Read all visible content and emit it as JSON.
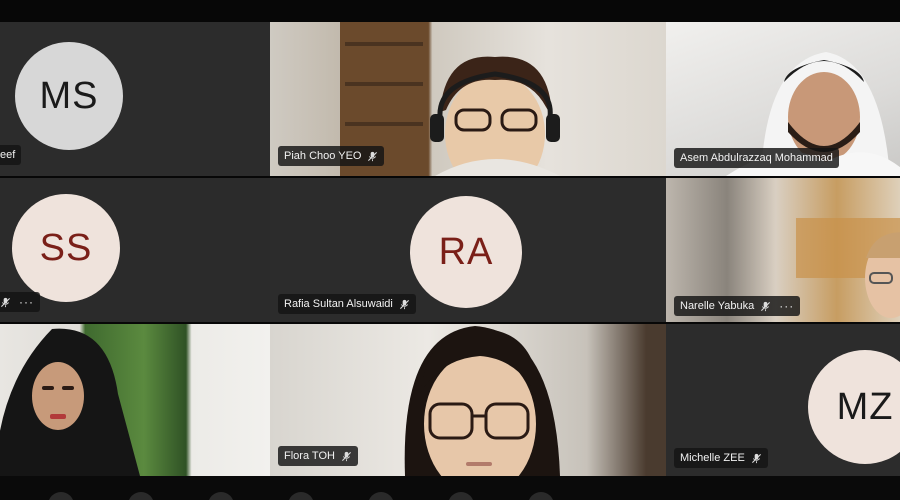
{
  "participants": [
    {
      "name": "Mohammed Shareef",
      "name_visible": "eef",
      "initials": "MS",
      "avatar_bg": "#d7d7d7",
      "avatar_fg": "#1a1a1a"
    },
    {
      "name": "Piah Choo YEO"
    },
    {
      "name": "Asem Abdulrazzaq Mohammad"
    },
    {
      "initials": "SS",
      "avatar_bg": "#efe3dc",
      "avatar_fg": "#7a1f18"
    },
    {
      "name": "Rafia Sultan Alsuwaidi",
      "initials": "RA",
      "avatar_bg": "#efe3dc",
      "avatar_fg": "#7a1f18"
    },
    {
      "name": "Narelle Yabuka"
    },
    {
      "name": "Flora TOH"
    },
    {
      "name": "Michelle ZEE",
      "initials": "MZ",
      "avatar_bg": "#efe3dc",
      "avatar_fg": "#1a1a1a"
    }
  ],
  "more_label": "···"
}
